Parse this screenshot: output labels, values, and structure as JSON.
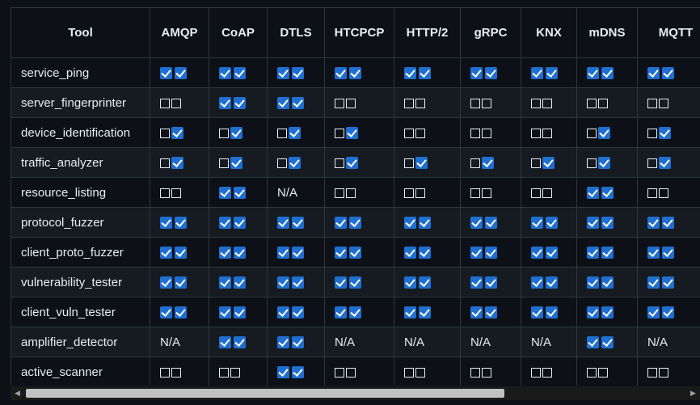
{
  "header": {
    "tool": "Tool",
    "protocols": [
      "AMQP",
      "CoAP",
      "DTLS",
      "HTCPCP",
      "HTTP/2",
      "gRPC",
      "KNX",
      "mDNS",
      "MQTT"
    ]
  },
  "rows": [
    {
      "tool": "service_ping",
      "cells": [
        "on-on",
        "on-on",
        "on-on",
        "on-on",
        "on-on",
        "on-on",
        "on-on",
        "on-on",
        "on-on"
      ]
    },
    {
      "tool": "server_fingerprinter",
      "cells": [
        "off-off",
        "on-on",
        "on-on",
        "off-off",
        "off-off",
        "off-off",
        "off-off",
        "off-off",
        "off-off"
      ]
    },
    {
      "tool": "device_identification",
      "cells": [
        "off-on",
        "off-on",
        "off-on",
        "off-on",
        "off-off",
        "off-off",
        "off-off",
        "off-on",
        "off-on"
      ]
    },
    {
      "tool": "traffic_analyzer",
      "cells": [
        "off-on",
        "off-on",
        "off-on",
        "off-on",
        "off-on",
        "off-on",
        "off-on",
        "off-on",
        "off-on"
      ]
    },
    {
      "tool": "resource_listing",
      "cells": [
        "off-off",
        "on-on",
        "N/A",
        "off-off",
        "off-off",
        "off-off",
        "off-off",
        "on-on",
        "off-off"
      ]
    },
    {
      "tool": "protocol_fuzzer",
      "cells": [
        "on-on",
        "on-on",
        "on-on",
        "on-on",
        "on-on",
        "on-on",
        "on-on",
        "on-on",
        "on-on"
      ]
    },
    {
      "tool": "client_proto_fuzzer",
      "cells": [
        "on-on",
        "on-on",
        "on-on",
        "on-on",
        "on-on",
        "on-on",
        "on-on",
        "on-on",
        "on-on"
      ]
    },
    {
      "tool": "vulnerability_tester",
      "cells": [
        "on-on",
        "on-on",
        "on-on",
        "on-on",
        "on-on",
        "on-on",
        "on-on",
        "on-on",
        "on-on"
      ]
    },
    {
      "tool": "client_vuln_tester",
      "cells": [
        "on-on",
        "on-on",
        "on-on",
        "on-on",
        "on-on",
        "on-on",
        "on-on",
        "on-on",
        "on-on"
      ]
    },
    {
      "tool": "amplifier_detector",
      "cells": [
        "N/A",
        "on-on",
        "on-on",
        "N/A",
        "N/A",
        "N/A",
        "N/A",
        "on-on",
        "N/A"
      ]
    },
    {
      "tool": "active_scanner",
      "cells": [
        "off-off",
        "off-off",
        "on-on",
        "off-off",
        "off-off",
        "off-off",
        "off-off",
        "off-off",
        "off-off"
      ]
    }
  ],
  "na_text": "N/A",
  "colors": {
    "checked_fill": "#1f6fd1",
    "background": "#0d1117",
    "alt_row": "#161b22",
    "grid": "#30363d"
  },
  "scrollbar": {
    "left_arrow_icon": "arrow-left-icon",
    "right_arrow_icon": "arrow-right-icon",
    "thumb_fraction": 0.7
  }
}
